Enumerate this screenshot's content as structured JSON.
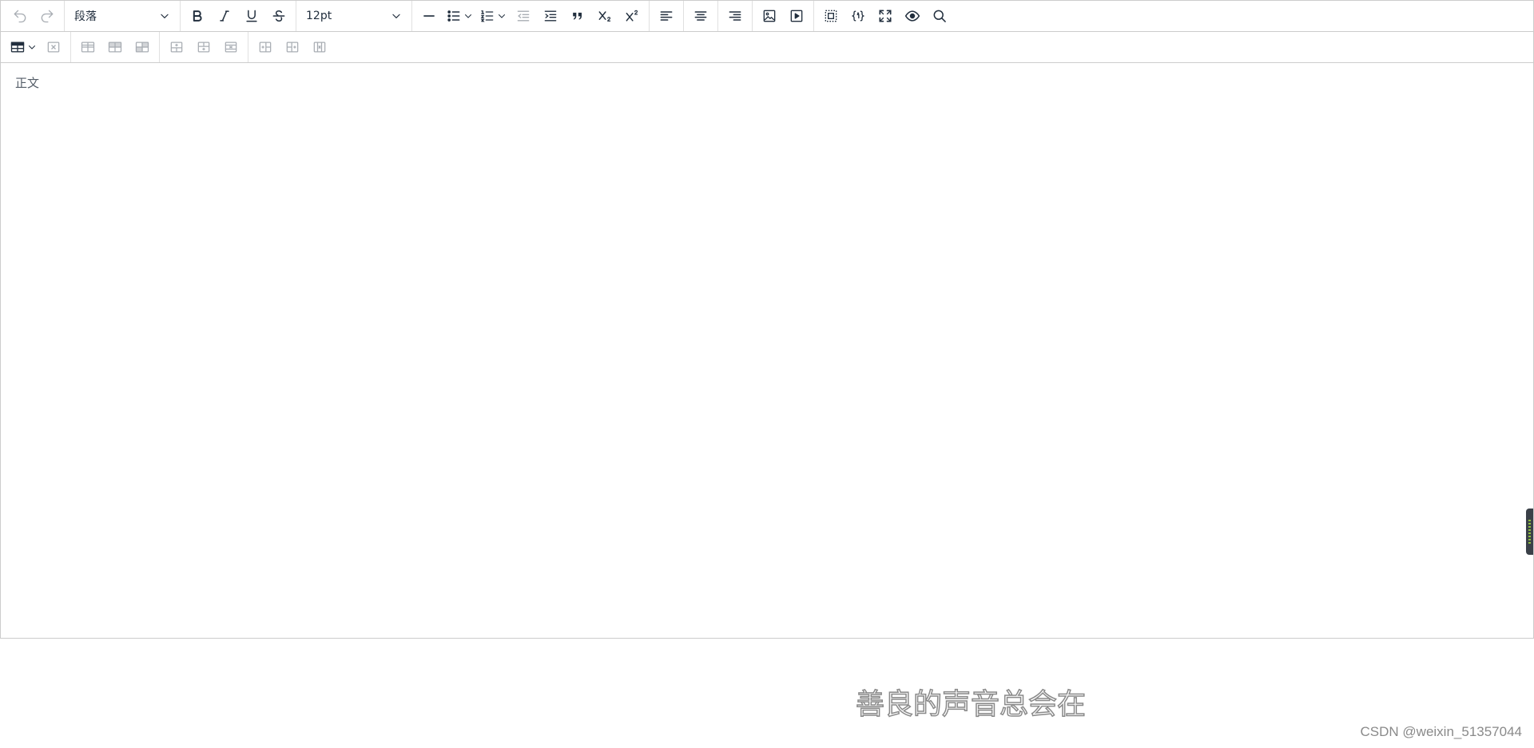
{
  "toolbar": {
    "undo_icon": "undo-icon",
    "redo_icon": "redo-icon",
    "blocks_select": {
      "value": "段落"
    },
    "formatting": [
      "bold-icon",
      "italic-icon",
      "underline-icon",
      "strikethrough-icon"
    ],
    "fontsize_select": {
      "value": "12pt"
    },
    "insert": [
      "horizontal-rule-icon",
      "bullet-list-icon",
      "numbered-list-icon",
      "outdent-icon",
      "indent-icon",
      "blockquote-icon",
      "subscript-icon",
      "superscript-icon"
    ],
    "align": [
      "align-left-icon",
      "align-center-icon",
      "align-right-icon"
    ],
    "media": [
      "image-icon",
      "media-icon"
    ],
    "tools": [
      "select-all-icon",
      "code-icon",
      "fullscreen-icon",
      "preview-icon",
      "search-icon"
    ]
  },
  "table_toolbar": {
    "items": [
      "table-icon",
      "delete-table-icon",
      "row-props-icon",
      "cell-props-icon",
      "table-props-icon",
      "insert-row-before-icon",
      "insert-row-after-icon",
      "delete-row-icon",
      "insert-col-before-icon",
      "insert-col-after-icon",
      "delete-col-icon"
    ]
  },
  "editor": {
    "body_text": "正文"
  },
  "footer": {
    "watermark": "善良的声音总会在",
    "credit": "CSDN @weixin_51357044"
  },
  "colors": {
    "icon": "#222f3e",
    "disabled_icon": "#a8adb3",
    "border": "#cccccc"
  }
}
